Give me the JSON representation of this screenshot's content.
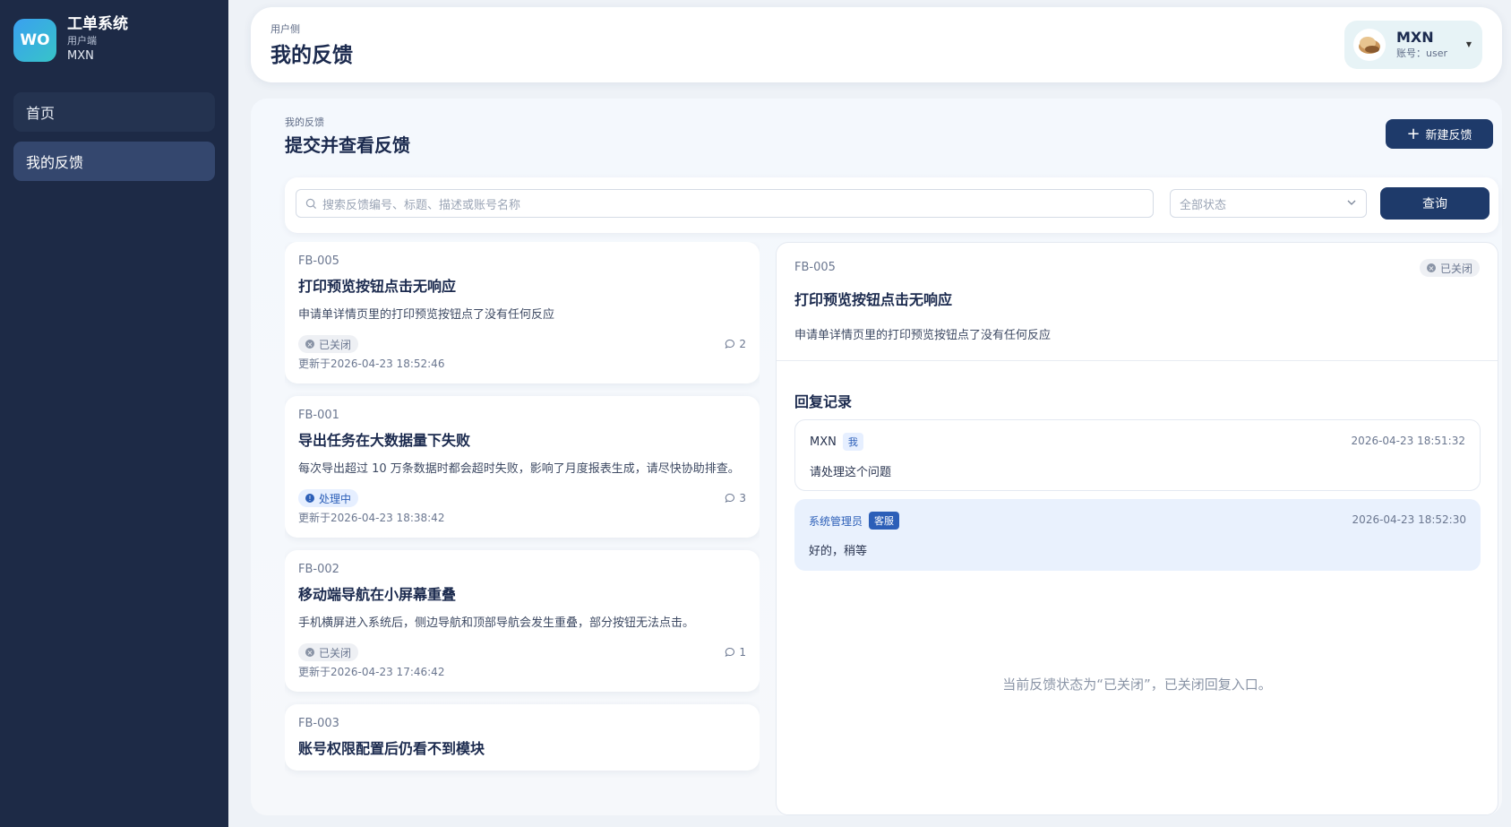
{
  "sidebar": {
    "logo_text": "WO",
    "app_name": "工单系统",
    "client_label": "用户端",
    "user_name": "MXN",
    "nav": [
      {
        "label": "首页"
      },
      {
        "label": "我的反馈"
      }
    ]
  },
  "header": {
    "crumb": "用户侧",
    "title": "我的反馈",
    "user": {
      "name": "MXN",
      "account": "账号：user"
    }
  },
  "section": {
    "crumb": "我的反馈",
    "title": "提交并查看反馈",
    "new_button": "新建反馈"
  },
  "search": {
    "placeholder": "搜索反馈编号、标题、描述或账号名称",
    "status_placeholder": "全部状态",
    "query_button": "查询"
  },
  "feedback_list": [
    {
      "code": "FB-005",
      "title": "打印预览按钮点击无响应",
      "desc": "申请单详情页里的打印预览按钮点了没有任何反应",
      "status": "已关闭",
      "comments": "2",
      "updated": "更新于2026-04-23 18:52:46"
    },
    {
      "code": "FB-001",
      "title": "导出任务在大数据量下失败",
      "desc": "每次导出超过 10 万条数据时都会超时失败，影响了月度报表生成，请尽快协助排查。",
      "status": "处理中",
      "comments": "3",
      "updated": "更新于2026-04-23 18:38:42"
    },
    {
      "code": "FB-002",
      "title": "移动端导航在小屏幕重叠",
      "desc": "手机横屏进入系统后，侧边导航和顶部导航会发生重叠，部分按钮无法点击。",
      "status": "已关闭",
      "comments": "1",
      "updated": "更新于2026-04-23 17:46:42"
    },
    {
      "code": "FB-003",
      "title": "账号权限配置后仍看不到模块"
    }
  ],
  "detail": {
    "code": "FB-005",
    "status": "已关闭",
    "title": "打印预览按钮点击无响应",
    "desc": "申请单详情页里的打印预览按钮点了没有任何反应",
    "replies_title": "回复记录",
    "replies": [
      {
        "name": "MXN",
        "tag": "我",
        "time": "2026-04-23 18:51:32",
        "text": "请处理这个问题"
      },
      {
        "name": "系统管理员",
        "tag": "客服",
        "time": "2026-04-23 18:52:30",
        "text": "好的，稍等"
      }
    ],
    "closed_note": "当前反馈状态为“已关闭”，已关闭回复入口。"
  },
  "colors": {
    "sidebar_bg": "#1d2a46",
    "primary": "#1e3a6a",
    "accent_blue": "#2c5fb8"
  }
}
